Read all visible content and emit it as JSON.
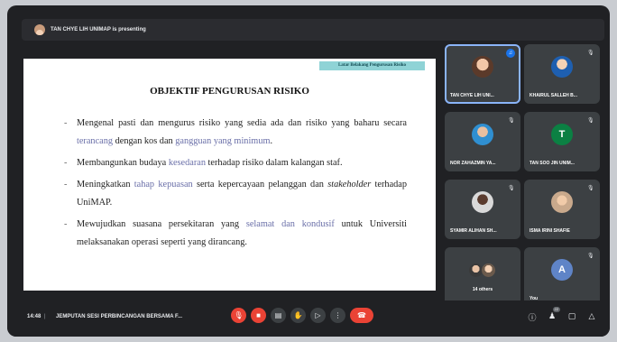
{
  "presenting": {
    "text": "TAN CHYE LIH UNIMAP is presenting",
    "avatar": "presenter-avatar"
  },
  "slide": {
    "tag": "Latar Belakang Pengurusan Risiko",
    "title": "OBJEKTIF PENGURUSAN RISIKO",
    "bullets": [
      {
        "a": "Mengenal pasti dan mengurus risiko yang sedia ada dan risiko yang baharu secara ",
        "h1": "terancang",
        "b": " dengan kos dan ",
        "h2": "gangguan yang minimum",
        "c": "."
      },
      {
        "a": "Membangunkan budaya ",
        "h1": "kesedaran",
        "b": " terhadap risiko dalam kalangan staf."
      },
      {
        "a": "Meningkatkan ",
        "h1": "tahap kepuasan",
        "b": " serta kepercayaan pelanggan dan ",
        "i": "stakeholder",
        "c": " terhadap UniMAP."
      },
      {
        "a": "Mewujudkan suasana persekitaran yang ",
        "h1": "selamat dan kondusif",
        "b": " untuk Universiti melaksanakan operasi seperti yang dirancang."
      }
    ]
  },
  "participants": [
    {
      "name": "TAN CHYE LIH UNI...",
      "avatar": "photo"
    },
    {
      "name": "KHAIRUL SALLEH B...",
      "avatar": "photo"
    },
    {
      "name": "NOR ZAHAZMIN YA...",
      "avatar": "photo"
    },
    {
      "name": "TAN SOO JIN UNIM...",
      "avatar": "T"
    },
    {
      "name": "SYAMIR ALIHAN SH...",
      "avatar": "photo"
    },
    {
      "name": "ISMA IRINI SHAFIE",
      "avatar": "photo"
    },
    {
      "name": "14 others",
      "avatar": "group"
    },
    {
      "name": "You",
      "avatar": "A"
    }
  ],
  "bottom": {
    "time": "14:48",
    "separator": "|",
    "meeting_title": "JEMPUTAN SESI PERBINCANGAN BERSAMA F...",
    "people_count": "22"
  },
  "controls": [
    "mic-off-icon",
    "camera-off-icon",
    "captions-icon",
    "raise-hand-icon",
    "present-icon",
    "more-icon",
    "end-call-icon"
  ],
  "colors": {
    "accent": "#8ab4f8",
    "danger": "#ea4335",
    "tile": "#3c4043",
    "highlight": "#6a6fa8"
  }
}
